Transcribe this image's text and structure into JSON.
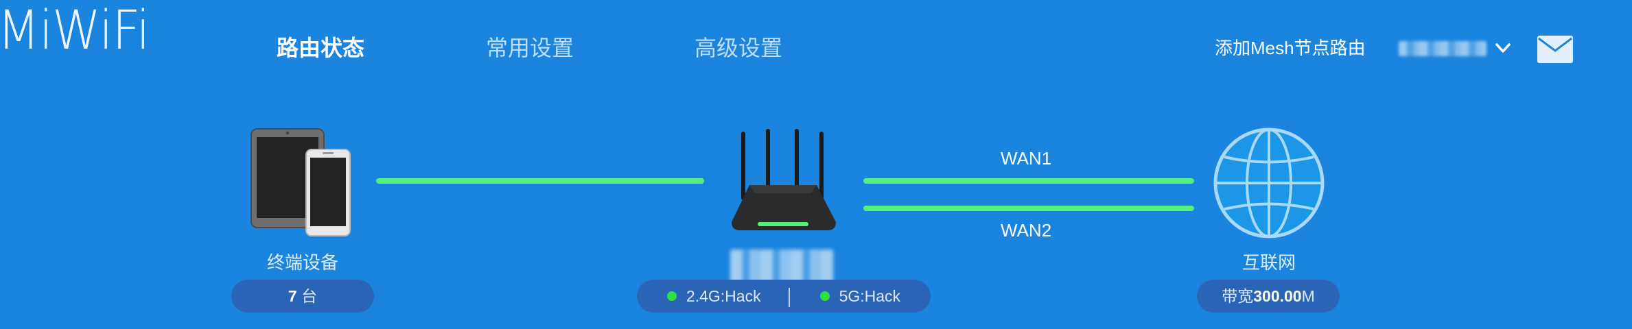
{
  "header": {
    "logo": "MiWiFi",
    "nav": [
      {
        "label": "路由状态",
        "active": true
      },
      {
        "label": "常用设置",
        "active": false
      },
      {
        "label": "高级设置",
        "active": false
      }
    ],
    "mesh_link": "添加Mesh节点路由"
  },
  "topology": {
    "clients": {
      "label": "终端设备",
      "count_value": "7",
      "count_unit": "台"
    },
    "router": {
      "wifi": [
        {
          "band": "2.4G",
          "ssid": "Hack",
          "text": "2.4G:Hack",
          "status_color": "#2fe043"
        },
        {
          "band": "5G",
          "ssid": "Hack",
          "text": "5G:Hack",
          "status_color": "#2fe043"
        }
      ]
    },
    "wan": [
      "WAN1",
      "WAN2"
    ],
    "internet": {
      "label": "互联网",
      "bandwidth_prefix": "带宽",
      "bandwidth_value": "300.00",
      "bandwidth_unit": "M"
    }
  },
  "colors": {
    "background": "#1a84de",
    "link_line": "#56f07c",
    "pill": "#2a64b6"
  }
}
